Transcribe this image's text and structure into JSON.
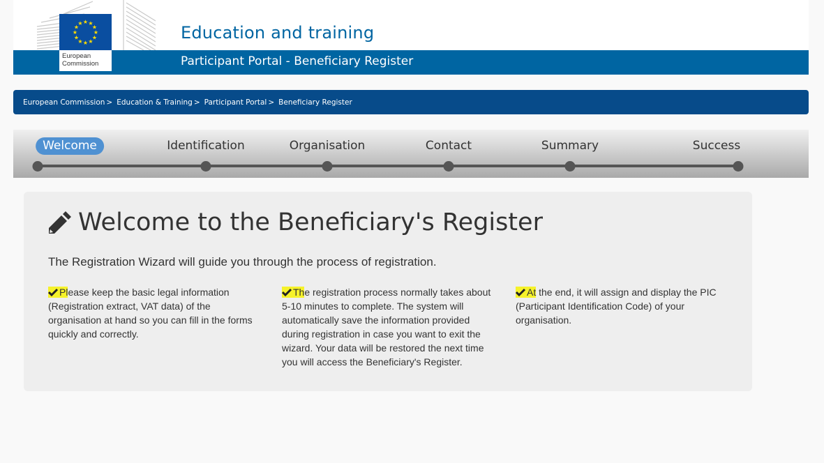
{
  "header": {
    "title": "Education and training",
    "subtitle": "Participant Portal - Beneficiary Register",
    "logo": {
      "line1": "European",
      "line2": "Commission",
      "icon": "eu-flag-icon"
    }
  },
  "breadcrumb": {
    "items": [
      {
        "label": "European Commission"
      },
      {
        "label": "Education & Training"
      },
      {
        "label": "Participant Portal"
      },
      {
        "label": "Beneficiary Register"
      }
    ],
    "separator": ">"
  },
  "wizard": {
    "active_step": 0,
    "steps": [
      {
        "label": "Welcome"
      },
      {
        "label": "Identification"
      },
      {
        "label": "Organisation"
      },
      {
        "label": "Contact"
      },
      {
        "label": "Summary"
      },
      {
        "label": "Success"
      }
    ]
  },
  "main": {
    "title": "Welcome to the Beneficiary's Register",
    "title_icon": "pencil-icon",
    "intro": "The Registration Wizard will guide you through the process of registration.",
    "highlight_color": "#f6f22a",
    "columns": [
      {
        "icon": "check-icon",
        "highlighted": "Pl",
        "rest": "ease keep the basic legal information (Registration extract, VAT data) of the organisation at hand so you can fill in the forms quickly and correctly."
      },
      {
        "icon": "check-icon",
        "highlighted": "Th",
        "rest": "e registration process normally takes about 5-10 minutes to complete. The system will automatically save the information provided during registration in case you want to exit the wizard. Your data will be restored the next time you will access the Beneficiary's Register."
      },
      {
        "icon": "check-icon",
        "highlighted": "At",
        "rest": " the end, it will assign and display the PIC (Participant Identification Code) of your organisation."
      }
    ]
  }
}
